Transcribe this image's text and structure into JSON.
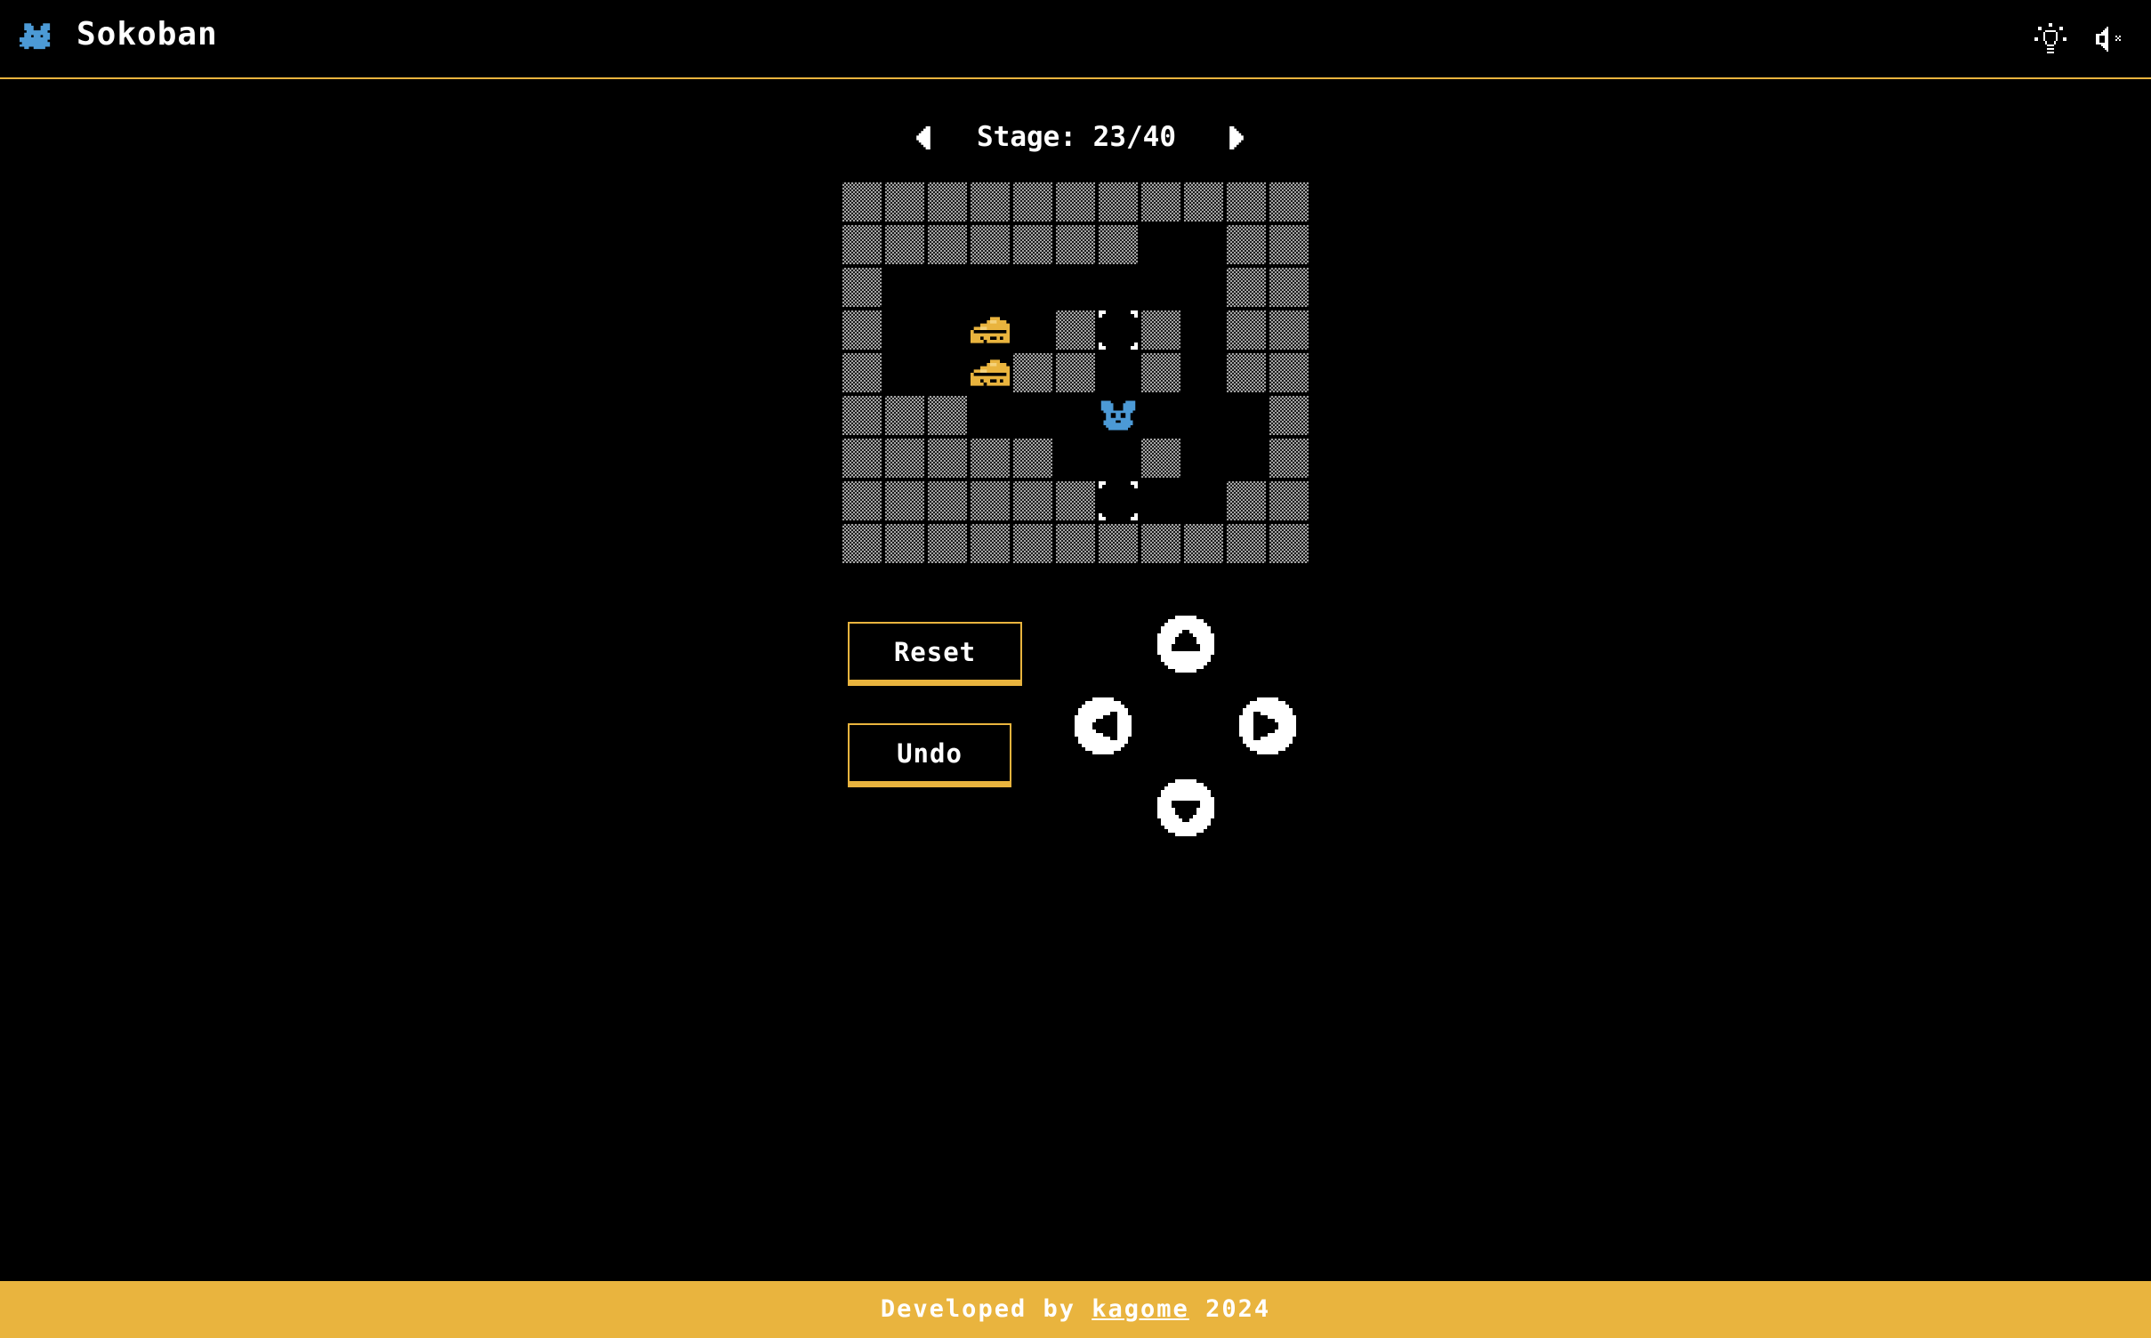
{
  "header": {
    "title": "Sokoban",
    "logo_icon": "mouse-icon",
    "hint_icon": "lightbulb-icon",
    "sound_icon": "speaker-muted-icon"
  },
  "stage": {
    "label": "Stage: 23/40",
    "prev_icon": "caret-left-icon",
    "next_icon": "caret-right-icon"
  },
  "board": {
    "cols": 11,
    "rows": 9,
    "legend": {
      "#": "wall",
      " ": "floor",
      ".": "goal",
      "$": "cheese-box",
      "@": "player-mouse"
    },
    "map": [
      "###########",
      "#######  ##",
      "#        ##",
      "#  $ #.# ##",
      "#  $## # ##",
      "###   @   #",
      "#####  #  #",
      "######.  ##",
      "###########"
    ]
  },
  "controls": {
    "reset_label": "Reset",
    "undo_label": "Undo",
    "dpad": [
      "arrow-up-icon",
      "arrow-left-icon",
      "arrow-right-icon",
      "arrow-down-icon"
    ]
  },
  "footer": {
    "prefix": "Developed by",
    "author": "kagome",
    "year": "2024"
  },
  "colors": {
    "accent": "#e9b43e",
    "background": "#000000",
    "player": "#4c9ad6",
    "wall": "#a5a5a5"
  }
}
